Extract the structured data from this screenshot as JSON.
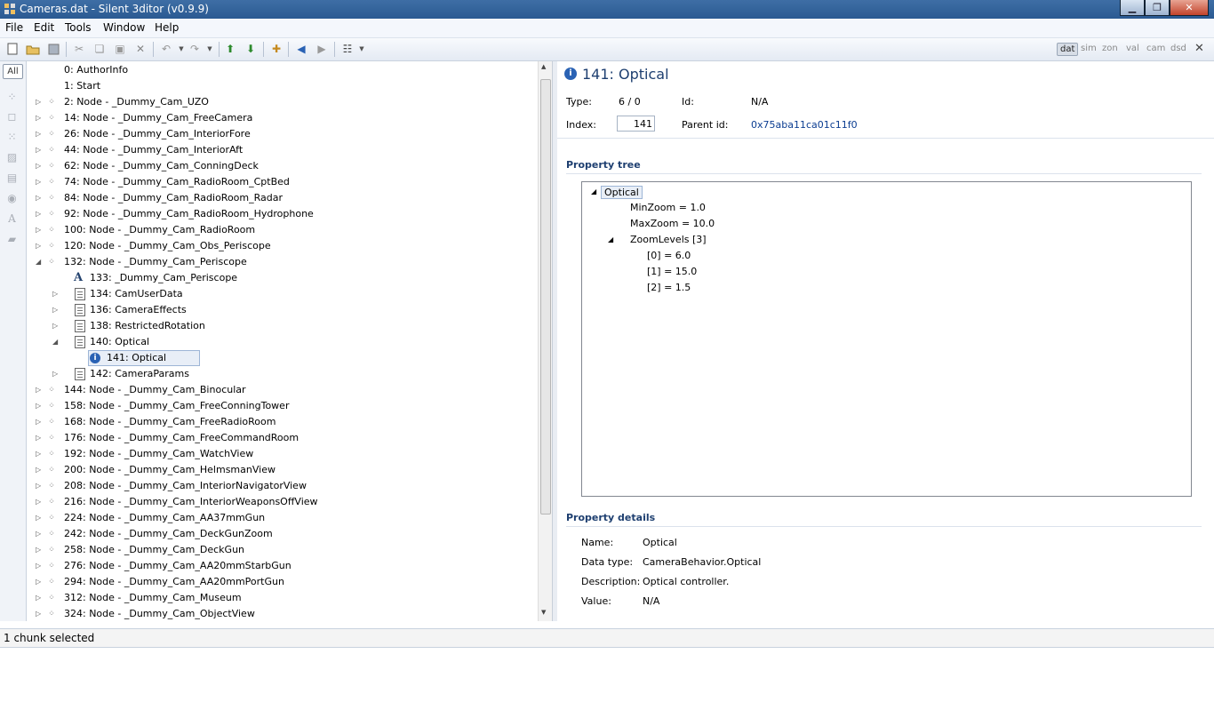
{
  "window": {
    "title": "Cameras.dat - Silent 3ditor (v0.9.9)"
  },
  "menu": [
    "File",
    "Edit",
    "Tools",
    "Window",
    "Help"
  ],
  "view_tabs": {
    "items": [
      "dat",
      "sim",
      "zon",
      "val",
      "cam",
      "dsd"
    ],
    "active": "dat"
  },
  "sidebar": {
    "all_label": "All"
  },
  "tree": [
    {
      "label": "0: AuthorInfo",
      "level": 0,
      "icon": "none",
      "expander": "none"
    },
    {
      "label": "1: Start",
      "level": 0,
      "icon": "none",
      "expander": "none"
    },
    {
      "label": "2: Node - _Dummy_Cam_UZO",
      "level": 0,
      "icon": "node",
      "expander": "collapsed"
    },
    {
      "label": "14: Node - _Dummy_Cam_FreeCamera",
      "level": 0,
      "icon": "node",
      "expander": "collapsed"
    },
    {
      "label": "26: Node - _Dummy_Cam_InteriorFore",
      "level": 0,
      "icon": "node",
      "expander": "collapsed"
    },
    {
      "label": "44: Node - _Dummy_Cam_InteriorAft",
      "level": 0,
      "icon": "node",
      "expander": "collapsed"
    },
    {
      "label": "62: Node - _Dummy_Cam_ConningDeck",
      "level": 0,
      "icon": "node",
      "expander": "collapsed"
    },
    {
      "label": "74: Node - _Dummy_Cam_RadioRoom_CptBed",
      "level": 0,
      "icon": "node",
      "expander": "collapsed"
    },
    {
      "label": "84: Node - _Dummy_Cam_RadioRoom_Radar",
      "level": 0,
      "icon": "node",
      "expander": "collapsed"
    },
    {
      "label": "92: Node - _Dummy_Cam_RadioRoom_Hydrophone",
      "level": 0,
      "icon": "node",
      "expander": "collapsed"
    },
    {
      "label": "100: Node - _Dummy_Cam_RadioRoom",
      "level": 0,
      "icon": "node",
      "expander": "collapsed"
    },
    {
      "label": "120: Node - _Dummy_Cam_Obs_Periscope",
      "level": 0,
      "icon": "node",
      "expander": "collapsed"
    },
    {
      "label": "132: Node - _Dummy_Cam_Periscope",
      "level": 0,
      "icon": "node",
      "expander": "expanded"
    },
    {
      "label": "133: _Dummy_Cam_Periscope",
      "level": 1,
      "icon": "label-a",
      "expander": "none"
    },
    {
      "label": "134: CamUserData",
      "level": 1,
      "icon": "doc",
      "expander": "collapsed"
    },
    {
      "label": "136: CameraEffects",
      "level": 1,
      "icon": "doc",
      "expander": "collapsed"
    },
    {
      "label": "138: RestrictedRotation",
      "level": 1,
      "icon": "doc",
      "expander": "collapsed"
    },
    {
      "label": "140: Optical",
      "level": 1,
      "icon": "doc",
      "expander": "expanded"
    },
    {
      "label": "141: Optical",
      "level": 2,
      "icon": "info",
      "expander": "none",
      "selected": true
    },
    {
      "label": "142: CameraParams",
      "level": 1,
      "icon": "doc",
      "expander": "collapsed"
    },
    {
      "label": "144: Node - _Dummy_Cam_Binocular",
      "level": 0,
      "icon": "node",
      "expander": "collapsed"
    },
    {
      "label": "158: Node - _Dummy_Cam_FreeConningTower",
      "level": 0,
      "icon": "node",
      "expander": "collapsed"
    },
    {
      "label": "168: Node - _Dummy_Cam_FreeRadioRoom",
      "level": 0,
      "icon": "node",
      "expander": "collapsed"
    },
    {
      "label": "176: Node - _Dummy_Cam_FreeCommandRoom",
      "level": 0,
      "icon": "node",
      "expander": "collapsed"
    },
    {
      "label": "192: Node - _Dummy_Cam_WatchView",
      "level": 0,
      "icon": "node",
      "expander": "collapsed"
    },
    {
      "label": "200: Node - _Dummy_Cam_HelmsmanView",
      "level": 0,
      "icon": "node",
      "expander": "collapsed"
    },
    {
      "label": "208: Node - _Dummy_Cam_InteriorNavigatorView",
      "level": 0,
      "icon": "node",
      "expander": "collapsed"
    },
    {
      "label": "216: Node - _Dummy_Cam_InteriorWeaponsOffView",
      "level": 0,
      "icon": "node",
      "expander": "collapsed"
    },
    {
      "label": "224: Node - _Dummy_Cam_AA37mmGun",
      "level": 0,
      "icon": "node",
      "expander": "collapsed"
    },
    {
      "label": "242: Node - _Dummy_Cam_DeckGunZoom",
      "level": 0,
      "icon": "node",
      "expander": "collapsed"
    },
    {
      "label": "258: Node - _Dummy_Cam_DeckGun",
      "level": 0,
      "icon": "node",
      "expander": "collapsed"
    },
    {
      "label": "276: Node - _Dummy_Cam_AA20mmStarbGun",
      "level": 0,
      "icon": "node",
      "expander": "collapsed"
    },
    {
      "label": "294: Node - _Dummy_Cam_AA20mmPortGun",
      "level": 0,
      "icon": "node",
      "expander": "collapsed"
    },
    {
      "label": "312: Node - _Dummy_Cam_Museum",
      "level": 0,
      "icon": "node",
      "expander": "collapsed"
    },
    {
      "label": "324: Node - _Dummy_Cam_ObjectView",
      "level": 0,
      "icon": "node",
      "expander": "collapsed"
    }
  ],
  "detail": {
    "title": "141: Optical",
    "type_label": "Type:",
    "type_value": "6 / 0",
    "id_label": "Id:",
    "id_value": "N/A",
    "index_label": "Index:",
    "index_value": "141",
    "parent_label": "Parent id:",
    "parent_value": "0x75aba11ca01c11f0",
    "property_tree_heading": "Property tree",
    "property_tree": [
      {
        "text": "Optical",
        "level": 0,
        "expander": "expanded",
        "selected": true
      },
      {
        "text": "MinZoom = 1.0",
        "level": 1,
        "expander": "none"
      },
      {
        "text": "MaxZoom = 10.0",
        "level": 1,
        "expander": "none"
      },
      {
        "text": "ZoomLevels [3]",
        "level": 1,
        "expander": "expanded"
      },
      {
        "text": "[0] = 6.0",
        "level": 2,
        "expander": "none"
      },
      {
        "text": "[1] = 15.0",
        "level": 2,
        "expander": "none"
      },
      {
        "text": "[2] = 1.5",
        "level": 2,
        "expander": "none"
      }
    ],
    "property_details_heading": "Property details",
    "details": [
      {
        "label": "Name:",
        "value": "Optical"
      },
      {
        "label": "Data type:",
        "value": "CameraBehavior.Optical"
      },
      {
        "label": "Description:",
        "value": "Optical controller."
      },
      {
        "label": "Value:",
        "value": "N/A"
      }
    ]
  },
  "status": {
    "text": "1 chunk selected"
  },
  "colors": {
    "accent": "#1e3f70",
    "link": "#0b3d91",
    "titlebar": "#2b5a92"
  }
}
